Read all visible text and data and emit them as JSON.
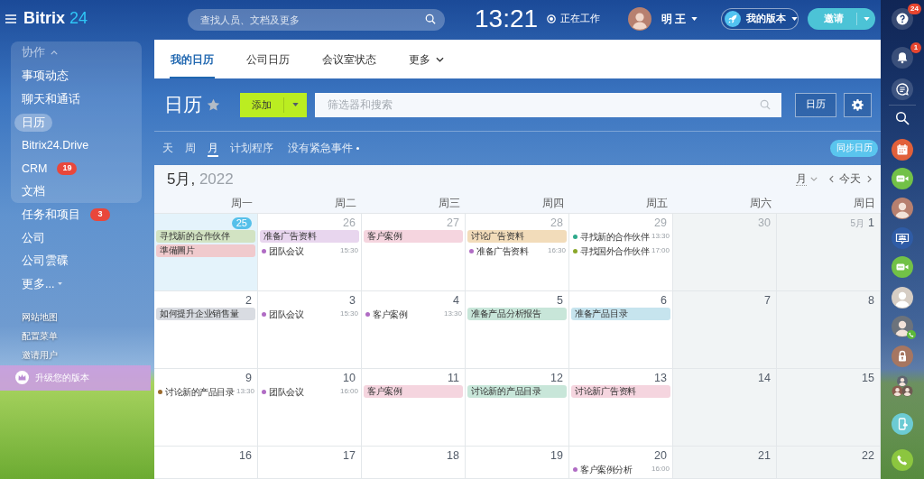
{
  "header": {
    "logo": {
      "name": "Bitrix",
      "number": "24"
    },
    "search": {
      "placeholder": "查找人员、文档及更多"
    },
    "clock": "13:21",
    "work_status": "正在工作",
    "user_name": "明 王",
    "plan_button": "我的版本",
    "invite_button": "邀请"
  },
  "sidebar": {
    "group": {
      "title": "协作",
      "expanded": true,
      "items": [
        {
          "label": "事项动态",
          "kind": "link",
          "selected": false
        },
        {
          "label": "聊天和通话",
          "kind": "link",
          "selected": false
        },
        {
          "label": "日历",
          "kind": "link",
          "selected": true
        },
        {
          "label": "Bitrix24.Drive",
          "kind": "link",
          "selected": false
        },
        {
          "label": "CRM",
          "kind": "link",
          "badge": "19",
          "selected": false
        },
        {
          "label": "文档",
          "kind": "link",
          "selected": false
        }
      ]
    },
    "items": [
      {
        "label": "任务和项目",
        "kind": "link",
        "badge": "3",
        "selected": false
      },
      {
        "label": "公司",
        "kind": "link",
        "selected": false
      },
      {
        "label": "公司雲碟",
        "kind": "link",
        "selected": false
      },
      {
        "label": "更多...",
        "kind": "menu",
        "selected": false
      }
    ],
    "links": [
      "网站地图",
      "配置菜单",
      "邀请用户"
    ],
    "upgrade_button": "升级您的版本"
  },
  "tabs": [
    {
      "label": "我的日历",
      "kind": "tab",
      "selected": true
    },
    {
      "label": "公司日历",
      "kind": "tab",
      "selected": false
    },
    {
      "label": "会议室状态",
      "kind": "tab",
      "selected": false
    },
    {
      "label": "更多",
      "kind": "menu",
      "selected": false
    }
  ],
  "toolbar": {
    "title": "日历",
    "favorite": false,
    "add_button": "添加",
    "filter": {
      "placeholder": "筛选器和搜索"
    },
    "calendar_button": "日历"
  },
  "views": {
    "modes": [
      {
        "label": "天",
        "selected": false
      },
      {
        "label": "周",
        "selected": false
      },
      {
        "label": "月",
        "selected": true
      },
      {
        "label": "计划程序",
        "selected": false
      }
    ],
    "urgent": "没有紧急事件",
    "sync_button": "同步日历"
  },
  "calendar": {
    "month": "5月,",
    "year": "2022",
    "view_select": "月",
    "today_button": "今天",
    "weekdays": [
      {
        "label": "周一",
        "weekend": false
      },
      {
        "label": "周二",
        "weekend": false
      },
      {
        "label": "周三",
        "weekend": false
      },
      {
        "label": "周四",
        "weekend": false
      },
      {
        "label": "周五",
        "weekend": false
      },
      {
        "label": "周六",
        "weekend": true
      },
      {
        "label": "周日",
        "weekend": true
      }
    ],
    "weeks": [
      [
        {
          "date": "25",
          "today": true,
          "dimmed": false,
          "events": [
            {
              "kind": "bar",
              "title": "寻找新的合作伙伴",
              "color": "#d2e3c3"
            },
            {
              "kind": "bar",
              "title": "準備圖片",
              "color": "#f0cacd"
            }
          ]
        },
        {
          "date": "26",
          "today": false,
          "dimmed": true,
          "events": [
            {
              "kind": "bar",
              "title": "准备广告资料",
              "color": "#e8d6ee"
            },
            {
              "kind": "dot",
              "title": "团队会议",
              "time": "15:30",
              "color": "#b06cc4"
            }
          ]
        },
        {
          "date": "27",
          "today": false,
          "dimmed": true,
          "events": [
            {
              "kind": "bar",
              "title": "客户案例",
              "color": "#f5d5df"
            }
          ]
        },
        {
          "date": "28",
          "today": false,
          "dimmed": true,
          "events": [
            {
              "kind": "bar",
              "title": "讨论广告资料",
              "color": "#f2dcba"
            },
            {
              "kind": "dot",
              "title": "准备广告资料",
              "time": "16:30",
              "color": "#b06cc4"
            }
          ]
        },
        {
          "date": "29",
          "today": false,
          "dimmed": true,
          "events": [
            {
              "kind": "dot",
              "title": "寻找新的合作伙伴",
              "time": "13:30",
              "color": "#2ea98b"
            },
            {
              "kind": "dot",
              "title": "寻找国外合作伙伴",
              "time": "17:00",
              "color": "#8aa72a"
            }
          ]
        },
        {
          "date": "30",
          "today": false,
          "dimmed": true
        },
        {
          "date": "1",
          "month_label": "5月",
          "today": false,
          "dimmed": false
        }
      ],
      [
        {
          "date": "2",
          "today": false,
          "dimmed": false,
          "events": [
            {
              "kind": "bar",
              "title": "如何提升企业销售量",
              "color": "#d9dce2"
            }
          ]
        },
        {
          "date": "3",
          "today": false,
          "dimmed": false,
          "events": [
            {
              "kind": "dot",
              "title": "团队会议",
              "time": "15:30",
              "color": "#b06cc4"
            }
          ]
        },
        {
          "date": "4",
          "today": false,
          "dimmed": false,
          "events": [
            {
              "kind": "dot",
              "title": "客户案例",
              "time": "13:30",
              "color": "#b06cc4"
            }
          ]
        },
        {
          "date": "5",
          "today": false,
          "dimmed": false,
          "events": [
            {
              "kind": "bar",
              "title": "准备产品分析报告",
              "color": "#c8e6d9"
            }
          ]
        },
        {
          "date": "6",
          "today": false,
          "dimmed": false,
          "events": [
            {
              "kind": "bar",
              "title": "准备产品目录",
              "color": "#c6e4ee"
            }
          ]
        },
        {
          "date": "7",
          "today": false,
          "dimmed": false
        },
        {
          "date": "8",
          "today": false,
          "dimmed": false
        }
      ],
      [
        {
          "date": "9",
          "today": false,
          "dimmed": false,
          "events": [
            {
              "kind": "dot",
              "title": "讨论新的产品目录",
              "time": "13:30",
              "color": "#9b6a2c"
            }
          ]
        },
        {
          "date": "10",
          "today": false,
          "dimmed": false,
          "events": [
            {
              "kind": "dot",
              "title": "团队会议",
              "time": "16:00",
              "color": "#b06cc4"
            }
          ]
        },
        {
          "date": "11",
          "today": false,
          "dimmed": false,
          "events": [
            {
              "kind": "bar",
              "title": "客户案例",
              "color": "#f5d5df"
            }
          ]
        },
        {
          "date": "12",
          "today": false,
          "dimmed": false,
          "events": [
            {
              "kind": "bar",
              "title": "讨论新的产品目录",
              "color": "#c8e6d9"
            }
          ]
        },
        {
          "date": "13",
          "today": false,
          "dimmed": false,
          "events": [
            {
              "kind": "bar",
              "title": "讨论新广告资料",
              "color": "#f5d5df"
            }
          ]
        },
        {
          "date": "14",
          "today": false,
          "dimmed": false
        },
        {
          "date": "15",
          "today": false,
          "dimmed": false
        }
      ],
      [
        {
          "date": "16",
          "today": false,
          "dimmed": false
        },
        {
          "date": "17",
          "today": false,
          "dimmed": false
        },
        {
          "date": "18",
          "today": false,
          "dimmed": false
        },
        {
          "date": "19",
          "today": false,
          "dimmed": false
        },
        {
          "date": "20",
          "today": false,
          "dimmed": false,
          "events": [
            {
              "kind": "dot",
              "title": "客户案例分析",
              "time": "16:00",
              "color": "#b06cc4"
            }
          ]
        },
        {
          "date": "21",
          "today": false,
          "dimmed": false
        },
        {
          "date": "22",
          "today": false,
          "dimmed": false
        }
      ]
    ]
  },
  "right_bar": {
    "help_badge": "24",
    "notification_badge": "1"
  }
}
